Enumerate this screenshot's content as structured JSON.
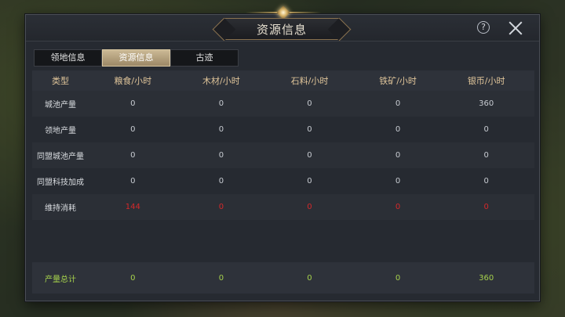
{
  "dialog": {
    "title": "资源信息",
    "help_glyph": "?"
  },
  "tabs": [
    {
      "label": "领地信息",
      "active": false
    },
    {
      "label": "资源信息",
      "active": true
    },
    {
      "label": "古迹",
      "active": false
    }
  ],
  "table": {
    "headers": [
      "类型",
      "粮食/小时",
      "木材/小时",
      "石料/小时",
      "铁矿/小时",
      "银币/小时"
    ],
    "rows": [
      {
        "label": "城池产量",
        "values": [
          "0",
          "0",
          "0",
          "0",
          "360"
        ]
      },
      {
        "label": "领地产量",
        "values": [
          "0",
          "0",
          "0",
          "0",
          "0"
        ]
      },
      {
        "label": "同盟城池产量",
        "values": [
          "0",
          "0",
          "0",
          "0",
          "0"
        ]
      },
      {
        "label": "同盟科技加成",
        "values": [
          "0",
          "0",
          "0",
          "0",
          "0"
        ]
      },
      {
        "label": "维持消耗",
        "values": [
          "144",
          "0",
          "0",
          "0",
          "0"
        ]
      }
    ],
    "total": {
      "label": "产量总计",
      "values": [
        "0",
        "0",
        "0",
        "0",
        "360"
      ]
    }
  },
  "colors": {
    "accent_gold": "#c9a762",
    "consumption_red": "#d4282a",
    "total_green": "#a6d24c"
  },
  "icons": {
    "help": "question-circle-icon",
    "close": "close-x-icon",
    "title_ornament": "gem-ornament-icon"
  }
}
